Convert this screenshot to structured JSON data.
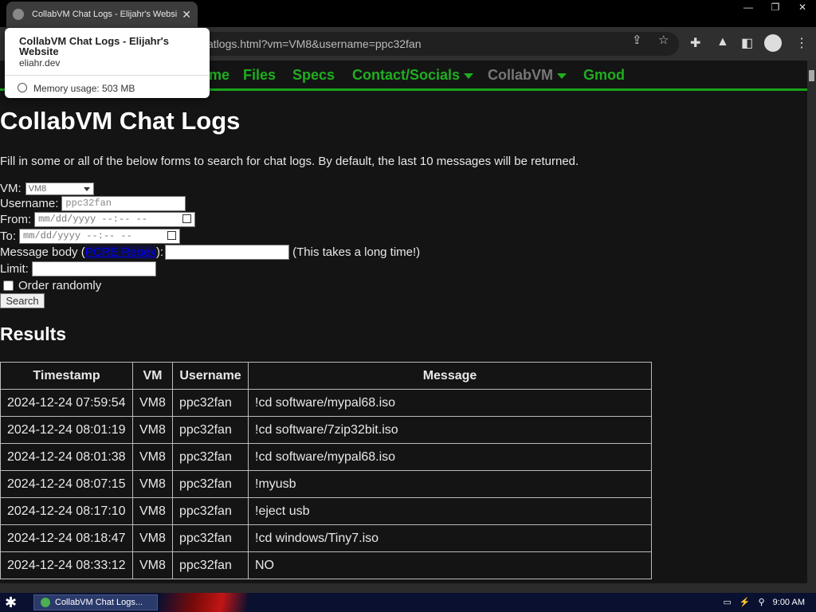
{
  "browser": {
    "tab_title": "CollabVM Chat Logs - Elijahr's Website",
    "tab_close": "✕",
    "window_controls": [
      "—",
      "❐",
      "✕"
    ],
    "url": "atlogs.html?vm=VM8&username=ppc32fan"
  },
  "hover_card": {
    "title": "CollabVM Chat Logs - Elijahr's Website",
    "domain": "eliahr.dev",
    "memory": "Memory usage: 503 MB"
  },
  "nav": {
    "items": [
      {
        "label": "me"
      },
      {
        "label": "Files"
      },
      {
        "label": "Specs"
      },
      {
        "label": "Contact/Socials"
      },
      {
        "label": "CollabVM"
      },
      {
        "label": "Gmod"
      }
    ]
  },
  "page": {
    "heading": "CollabVM Chat Logs",
    "intro": "Fill in some or all of the below forms to search for chat logs. By default, the last 10 messages will be returned."
  },
  "form": {
    "vm_label": "VM:",
    "vm_value": "VM8",
    "username_label": "Username:",
    "username_value": "ppc32fan",
    "from_label": "From:",
    "from_placeholder": "mm/dd/yyyy --:-- --",
    "to_label": "To:",
    "to_placeholder": "mm/dd/yyyy --:-- --",
    "message_label_pre": "Message body (",
    "message_link": "PCRE Regex",
    "message_label_post": "):",
    "message_note": "(This takes a long time!)",
    "limit_label": "Limit:",
    "random_label": "Order randomly",
    "search_label": "Search"
  },
  "results": {
    "heading": "Results",
    "columns": [
      "Timestamp",
      "VM",
      "Username",
      "Message"
    ],
    "rows": [
      [
        "2024-12-24 07:59:54",
        "VM8",
        "ppc32fan",
        "!cd software/mypal68.iso"
      ],
      [
        "2024-12-24 08:01:19",
        "VM8",
        "ppc32fan",
        "!cd software/7zip32bit.iso"
      ],
      [
        "2024-12-24 08:01:38",
        "VM8",
        "ppc32fan",
        "!cd software/mypal68.iso"
      ],
      [
        "2024-12-24 08:07:15",
        "VM8",
        "ppc32fan",
        "!myusb"
      ],
      [
        "2024-12-24 08:17:10",
        "VM8",
        "ppc32fan",
        "!eject usb"
      ],
      [
        "2024-12-24 08:18:47",
        "VM8",
        "ppc32fan",
        "!cd windows/Tiny7.iso"
      ],
      [
        "2024-12-24 08:33:12",
        "VM8",
        "ppc32fan",
        "NO"
      ]
    ]
  },
  "taskbar": {
    "item": "CollabVM Chat Logs...",
    "clock": "9:00 AM"
  },
  "colors": {
    "nav_green": "#1fae1f",
    "page_bg": "#141414"
  }
}
